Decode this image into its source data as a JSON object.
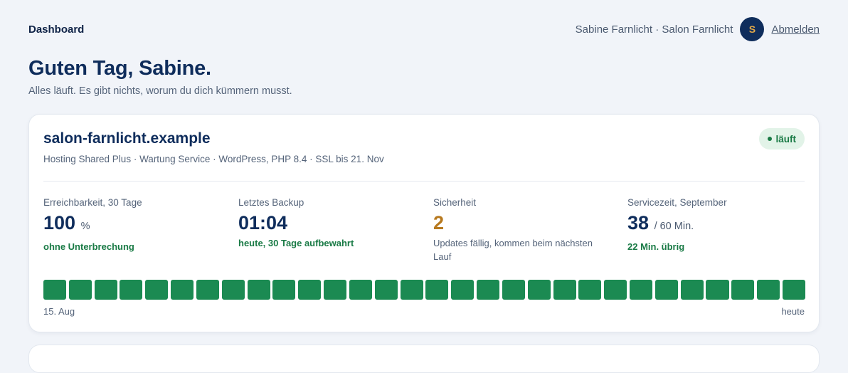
{
  "header": {
    "title": "Dashboard",
    "user_text": "Sabine Farnlicht · Salon Farnlicht",
    "avatar_initial": "S",
    "logout_label": "Abmelden"
  },
  "greeting": {
    "title": "Guten Tag, Sabine.",
    "subtitle": "Alles läuft. Es gibt nichts, worum du dich kümmern musst."
  },
  "site": {
    "name": "salon-farnlicht.example",
    "meta": "Hosting Shared Plus · Wartung Service · WordPress, PHP 8.4 · SSL bis 21. Nov",
    "status": "läuft",
    "status_color": "#197a45",
    "stats": [
      {
        "label": "Erreichbarkeit, 30 Tage",
        "value": "100",
        "unit": "%",
        "note": "ohne Unterbrechung"
      },
      {
        "label": "Letztes Backup",
        "value": "01:04",
        "unit": "",
        "note": "heute, 30 Tage aufbewahrt"
      },
      {
        "label": "Sicherheit",
        "value": "2",
        "unit": "",
        "note": "Updates fällig, kommen beim nächsten Lauf"
      },
      {
        "label": "Servicezeit, September",
        "value": "38",
        "unit": "/ 60 Min.",
        "note": "22 Min. übrig"
      }
    ],
    "uptime": {
      "days": 30,
      "days_up": 30,
      "color_up": "#1b8a52",
      "start_label": "15. Aug",
      "end_label": "heute"
    }
  }
}
